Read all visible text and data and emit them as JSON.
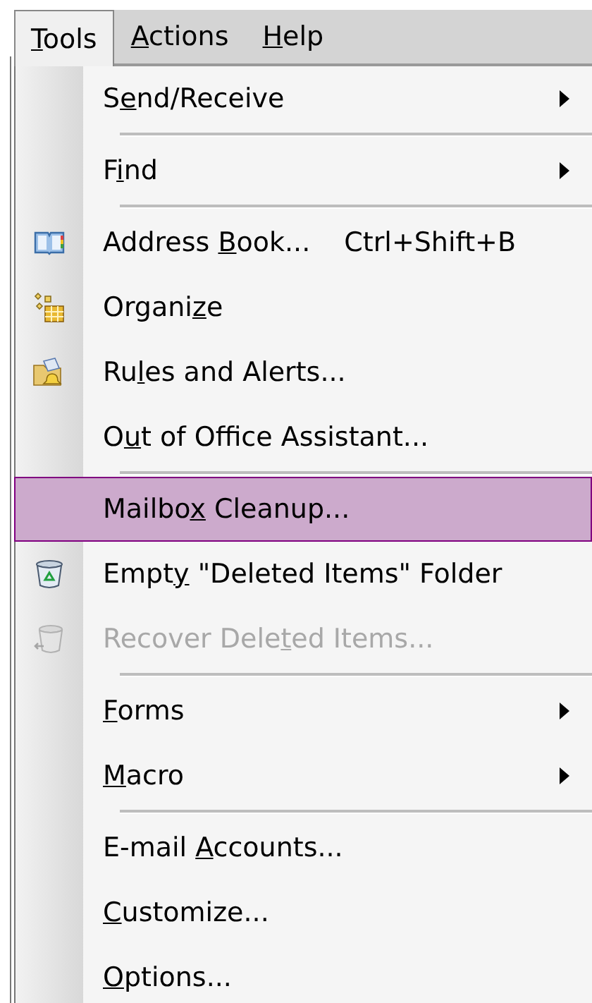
{
  "menu_bar": [
    {
      "label": [
        {
          "text": "T",
          "underline": true
        },
        {
          "text": "ools",
          "underline": false
        }
      ],
      "selected": true
    },
    {
      "label": [
        {
          "text": "A",
          "underline": true
        },
        {
          "text": "ctions",
          "underline": false
        }
      ],
      "selected": false
    },
    {
      "label": [
        {
          "text": "H",
          "underline": true
        },
        {
          "text": "elp",
          "underline": false
        }
      ],
      "selected": false
    }
  ],
  "menu": [
    {
      "kind": "item",
      "label": [
        {
          "text": "S",
          "underline": false
        },
        {
          "text": "e",
          "underline": true
        },
        {
          "text": "nd/Receive",
          "underline": false
        }
      ],
      "submenu": true,
      "disabled": false,
      "selected": false
    },
    {
      "kind": "separator"
    },
    {
      "kind": "item",
      "label": [
        {
          "text": "F",
          "underline": false
        },
        {
          "text": "i",
          "underline": true
        },
        {
          "text": "nd",
          "underline": false
        }
      ],
      "submenu": true,
      "disabled": false,
      "selected": false
    },
    {
      "kind": "separator"
    },
    {
      "kind": "item",
      "label": [
        {
          "text": "Address ",
          "underline": false
        },
        {
          "text": "B",
          "underline": true
        },
        {
          "text": "ook...",
          "underline": false
        }
      ],
      "shortcut": "Ctrl+Shift+B",
      "submenu": false,
      "disabled": false,
      "selected": false
    },
    {
      "kind": "item",
      "label": [
        {
          "text": "Organi",
          "underline": false
        },
        {
          "text": "z",
          "underline": true
        },
        {
          "text": "e",
          "underline": false
        }
      ],
      "submenu": false,
      "disabled": false,
      "selected": false
    },
    {
      "kind": "item",
      "label": [
        {
          "text": "Ru",
          "underline": false
        },
        {
          "text": "l",
          "underline": true
        },
        {
          "text": "es and Alerts...",
          "underline": false
        }
      ],
      "submenu": false,
      "disabled": false,
      "selected": false
    },
    {
      "kind": "item",
      "label": [
        {
          "text": "O",
          "underline": false
        },
        {
          "text": "u",
          "underline": true
        },
        {
          "text": "t of Office Assistant...",
          "underline": false
        }
      ],
      "submenu": false,
      "disabled": false,
      "selected": false
    },
    {
      "kind": "separator"
    },
    {
      "kind": "item",
      "label": [
        {
          "text": "Mailbo",
          "underline": false
        },
        {
          "text": "x",
          "underline": true
        },
        {
          "text": " Cleanup...",
          "underline": false
        }
      ],
      "submenu": false,
      "disabled": false,
      "selected": true
    },
    {
      "kind": "item",
      "label": [
        {
          "text": "Empt",
          "underline": false
        },
        {
          "text": "y",
          "underline": true
        },
        {
          "text": " \"Deleted Items\" Folder",
          "underline": false
        }
      ],
      "submenu": false,
      "disabled": false,
      "selected": false
    },
    {
      "kind": "item",
      "label": [
        {
          "text": "Recover Dele",
          "underline": false
        },
        {
          "text": "t",
          "underline": true
        },
        {
          "text": "ed Items...",
          "underline": false
        }
      ],
      "submenu": false,
      "disabled": true,
      "selected": false
    },
    {
      "kind": "separator"
    },
    {
      "kind": "item",
      "label": [
        {
          "text": "F",
          "underline": true
        },
        {
          "text": "orms",
          "underline": false
        }
      ],
      "submenu": true,
      "disabled": false,
      "selected": false
    },
    {
      "kind": "item",
      "label": [
        {
          "text": "M",
          "underline": true
        },
        {
          "text": "acro",
          "underline": false
        }
      ],
      "submenu": true,
      "disabled": false,
      "selected": false
    },
    {
      "kind": "separator"
    },
    {
      "kind": "item",
      "label": [
        {
          "text": "E-mail ",
          "underline": false
        },
        {
          "text": "A",
          "underline": true
        },
        {
          "text": "ccounts...",
          "underline": false
        }
      ],
      "submenu": false,
      "disabled": false,
      "selected": false
    },
    {
      "kind": "item",
      "label": [
        {
          "text": "C",
          "underline": true
        },
        {
          "text": "ustomize...",
          "underline": false
        }
      ],
      "submenu": false,
      "disabled": false,
      "selected": false
    },
    {
      "kind": "item",
      "label": [
        {
          "text": "O",
          "underline": true
        },
        {
          "text": "ptions...",
          "underline": false
        }
      ],
      "submenu": false,
      "disabled": false,
      "selected": false
    }
  ]
}
